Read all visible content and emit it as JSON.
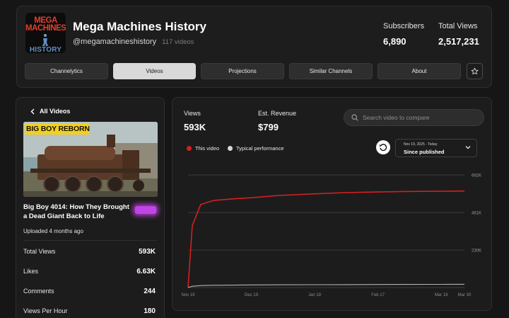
{
  "channel": {
    "logo_text_top": "MEGA MACHINES",
    "logo_text_bottom": "HISTORY",
    "name": "Mega Machines History",
    "handle": "@megamachineshistory",
    "video_count": "117 videos",
    "subscribers_label": "Subscribers",
    "subscribers_value": "6,890",
    "total_views_label": "Total Views",
    "total_views_value": "2,517,231"
  },
  "tabs": [
    {
      "label": "Channelytics",
      "active": false
    },
    {
      "label": "Videos",
      "active": true
    },
    {
      "label": "Projections",
      "active": false
    },
    {
      "label": "Similar Channels",
      "active": false
    },
    {
      "label": "About",
      "active": false
    }
  ],
  "video": {
    "back_label": "All Videos",
    "thumbnail_text": "BIG BOY REBORN",
    "title": "Big Boy 4014: How They Brought a Dead Giant Back to Life",
    "uploaded": "Uploaded 4 months ago",
    "metrics": [
      {
        "label": "Total Views",
        "value": "593K"
      },
      {
        "label": "Likes",
        "value": "6.63K"
      },
      {
        "label": "Comments",
        "value": "244"
      },
      {
        "label": "Views Per Hour",
        "value": "180"
      }
    ]
  },
  "performance": {
    "views_label": "Views",
    "views_value": "593K",
    "revenue_label": "Est. Revenue",
    "revenue_value": "$799",
    "search_placeholder": "Search video to compare",
    "legend_this": "This video",
    "legend_typical": "Typical performance",
    "date_range": "Nov 19, 2025 - Today",
    "date_mode": "Since published"
  },
  "colors": {
    "this_video": "#d42020",
    "typical": "#d8d8d8",
    "glow_badge": "#c244e8"
  },
  "chart_data": {
    "type": "line",
    "x": [
      "Nov 19",
      "Nov 21",
      "Nov 25",
      "Dec 1",
      "Dec 10",
      "Dec 19",
      "Jan 1",
      "Jan 18",
      "Feb 1",
      "Feb 17",
      "Mar 1",
      "Mar 19",
      "Mar 30"
    ],
    "x_tick_labels": [
      "Nov 19",
      "Dec 19",
      "Jan 18",
      "Feb 17",
      "Mar 19",
      "Mar 30"
    ],
    "y_tick_labels": [
      "230K",
      "461K",
      "692K"
    ],
    "ylim": [
      0,
      692000
    ],
    "series": [
      {
        "name": "This video",
        "values": [
          0,
          380000,
          510000,
          535000,
          545000,
          552000,
          566000,
          576000,
          583000,
          587000,
          590000,
          592000,
          593000
        ]
      },
      {
        "name": "Typical performance",
        "values": [
          0,
          8000,
          12000,
          14000,
          15000,
          16000,
          17000,
          17500,
          18000,
          18500,
          19000,
          19500,
          20000
        ]
      }
    ],
    "grid": true
  }
}
